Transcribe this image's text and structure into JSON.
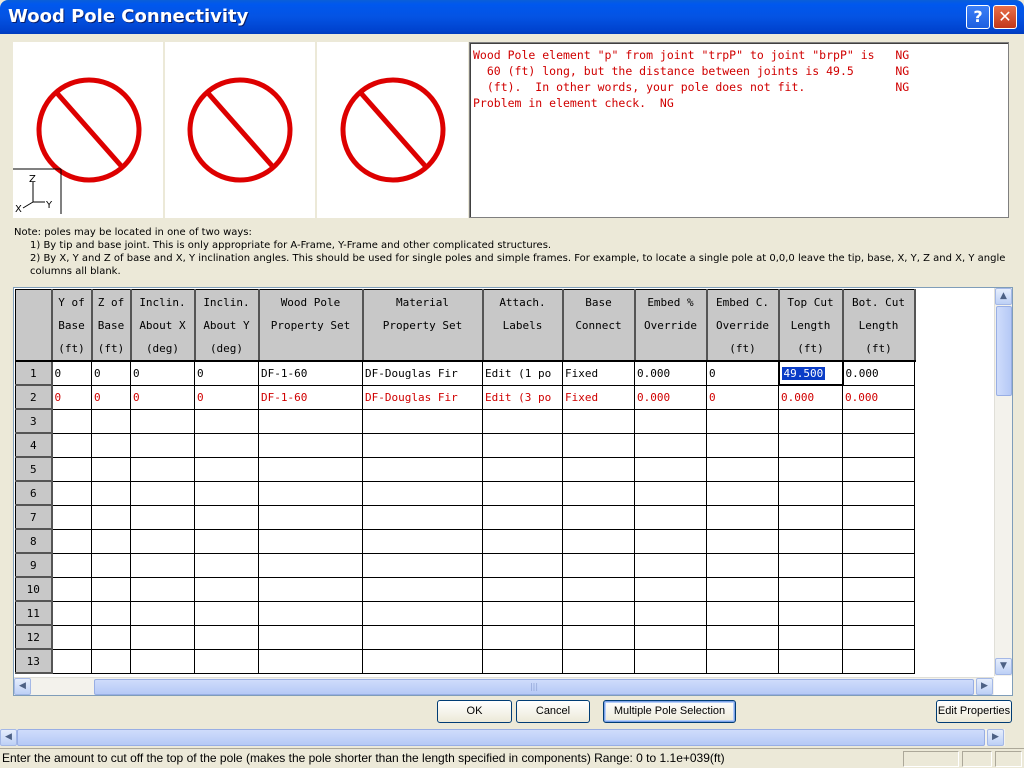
{
  "window": {
    "title": "Wood Pole Connectivity",
    "help_label": "?",
    "close_label": "✕"
  },
  "preview": {
    "panels": [
      "no-preview-1",
      "no-preview-2",
      "no-preview-3"
    ],
    "axis": {
      "z": "Z",
      "x": "X",
      "y": "Y"
    },
    "symbol_color": "#dd0000"
  },
  "message": {
    "lines": [
      "Wood Pole element \"p\" from joint \"trpP\" to joint \"brpP\" is   NG",
      "  60 (ft) long, but the distance between joints is 49.5      NG",
      "  (ft).  In other words, your pole does not fit.             NG",
      "Problem in element check.  NG"
    ],
    "color": "#d00000"
  },
  "notes": {
    "line1": "Note: poles may be located in one of two ways:",
    "line2": "1)  By tip and base joint.  This is only appropriate for A-Frame, Y-Frame and other complicated structures.",
    "line3": "2)  By X, Y and Z of base and X, Y inclination angles.  This should be used for single poles and simple frames.  For example, to locate a single pole at 0,0,0 leave the tip, base, X, Y, Z and X, Y angle columns all blank."
  },
  "grid": {
    "columns": [
      {
        "l1": "Y of",
        "l2": "Base",
        "l3": "(ft)"
      },
      {
        "l1": "Z of",
        "l2": "Base",
        "l3": "(ft)"
      },
      {
        "l1": "Inclin.",
        "l2": "About X",
        "l3": "(deg)"
      },
      {
        "l1": "Inclin.",
        "l2": "About Y",
        "l3": "(deg)"
      },
      {
        "l1": "Wood Pole",
        "l2": "Property Set",
        "l3": ""
      },
      {
        "l1": "Material",
        "l2": "Property Set",
        "l3": ""
      },
      {
        "l1": "Attach.",
        "l2": "Labels",
        "l3": ""
      },
      {
        "l1": "Base",
        "l2": "Connect",
        "l3": ""
      },
      {
        "l1": "Embed %",
        "l2": "Override",
        "l3": ""
      },
      {
        "l1": "Embed C.",
        "l2": "Override",
        "l3": "(ft)"
      },
      {
        "l1": "Top Cut",
        "l2": "Length",
        "l3": "(ft)"
      },
      {
        "l1": "Bot. Cut",
        "l2": "Length",
        "l3": "(ft)"
      }
    ],
    "rows": [
      {
        "n": "1",
        "cells": [
          "0",
          "0",
          "0",
          "0",
          "DF-1-60",
          "DF-Douglas Fir",
          "Edit (1 po",
          "Fixed",
          "0.000",
          "0",
          "49.500",
          "0.000"
        ]
      },
      {
        "n": "2",
        "cells": [
          "0",
          "0",
          "0",
          "0",
          "DF-1-60",
          "DF-Douglas Fir",
          "Edit (3 po",
          "Fixed",
          "0.000",
          "0",
          "0.000",
          "0.000"
        ]
      },
      {
        "n": "3",
        "cells": []
      },
      {
        "n": "4",
        "cells": []
      },
      {
        "n": "5",
        "cells": []
      },
      {
        "n": "6",
        "cells": []
      },
      {
        "n": "7",
        "cells": []
      },
      {
        "n": "8",
        "cells": []
      },
      {
        "n": "9",
        "cells": []
      },
      {
        "n": "10",
        "cells": []
      },
      {
        "n": "11",
        "cells": []
      },
      {
        "n": "12",
        "cells": []
      },
      {
        "n": "13",
        "cells": []
      }
    ],
    "error_row_color": "#d00000",
    "selected_cell": {
      "row": "1",
      "column": "Top Cut Length",
      "value": "49.500"
    }
  },
  "buttons": {
    "ok": "OK",
    "cancel": "Cancel",
    "multiple_pole": "Multiple Pole Selection",
    "edit_properties": "Edit Properties"
  },
  "statusbar": {
    "text": "Enter the amount to cut off the top of the pole (makes the pole shorter than the length specified in components)  Range: 0 to 1.1e+039(ft)"
  }
}
